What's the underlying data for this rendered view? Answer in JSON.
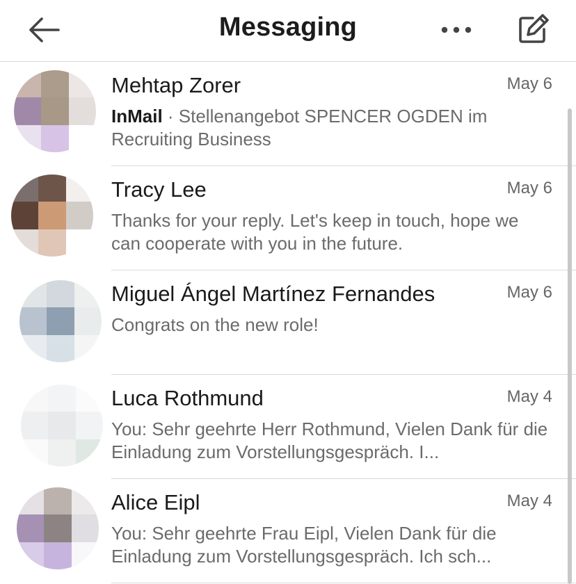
{
  "header": {
    "title": "Messaging",
    "back_icon": "arrow-left-icon",
    "more_icon": "more-horizontal-icon",
    "compose_icon": "compose-icon"
  },
  "conversations": [
    {
      "name": "Mehtap Zorer",
      "date": "May 6",
      "tag": "InMail",
      "separator": " · ",
      "snippet": "Stellenangebot SPENCER OGDEN im Recruiting Business",
      "avatar_colors": [
        "#c9b5ad",
        "#ab9c8b",
        "#ece6e4",
        "#a089a8",
        "#a79887",
        "#e3dedc",
        "#e9e1ee",
        "#d6c3e6",
        "#ffffff"
      ]
    },
    {
      "name": "Tracy Lee",
      "date": "May 6",
      "snippet": "Thanks for your reply. Let's keep in touch, hope we can cooperate with you in the future.",
      "avatar_colors": [
        "#7b6f6e",
        "#6e5549",
        "#f3efed",
        "#5d4337",
        "#cd9a76",
        "#d2ccc7",
        "#e3dcd9",
        "#e0c6b6",
        "#ffffff"
      ]
    },
    {
      "name": "Miguel Ángel Martínez Fernandes",
      "date": "May 6",
      "snippet": "Congrats on the new role!",
      "avatar_colors": [
        "#e1e5e6",
        "#d2d8dd",
        "#eef0ef",
        "#b9c3d0",
        "#8d9fb0",
        "#e9ecec",
        "#e8ecf0",
        "#d6e0e6",
        "#f5f5f5"
      ]
    },
    {
      "name": "Luca Rothmund",
      "date": "May 4",
      "snippet": "You: Sehr geehrte Herr Rothmund,  Vielen Dank für die Einladung zum Vorstellungsgespräch. I...",
      "avatar_colors": [
        "#f7f7f8",
        "#f3f4f5",
        "#fbfbfb",
        "#eeeff1",
        "#e7e9eb",
        "#f2f3f4",
        "#fafafa",
        "#eef1ef",
        "#dfe8e2"
      ]
    },
    {
      "name": "Alice Eipl",
      "date": "May 4",
      "snippet": "You: Sehr geehrte Frau Eipl,  Vielen Dank für die Einladung zum Vorstellungsgespräch. Ich sch...",
      "avatar_colors": [
        "#e4e0e3",
        "#bcb2ad",
        "#eceaea",
        "#a691b4",
        "#8c8482",
        "#e0dde3",
        "#d8cce8",
        "#c6b4de",
        "#f8f7f9"
      ]
    }
  ]
}
